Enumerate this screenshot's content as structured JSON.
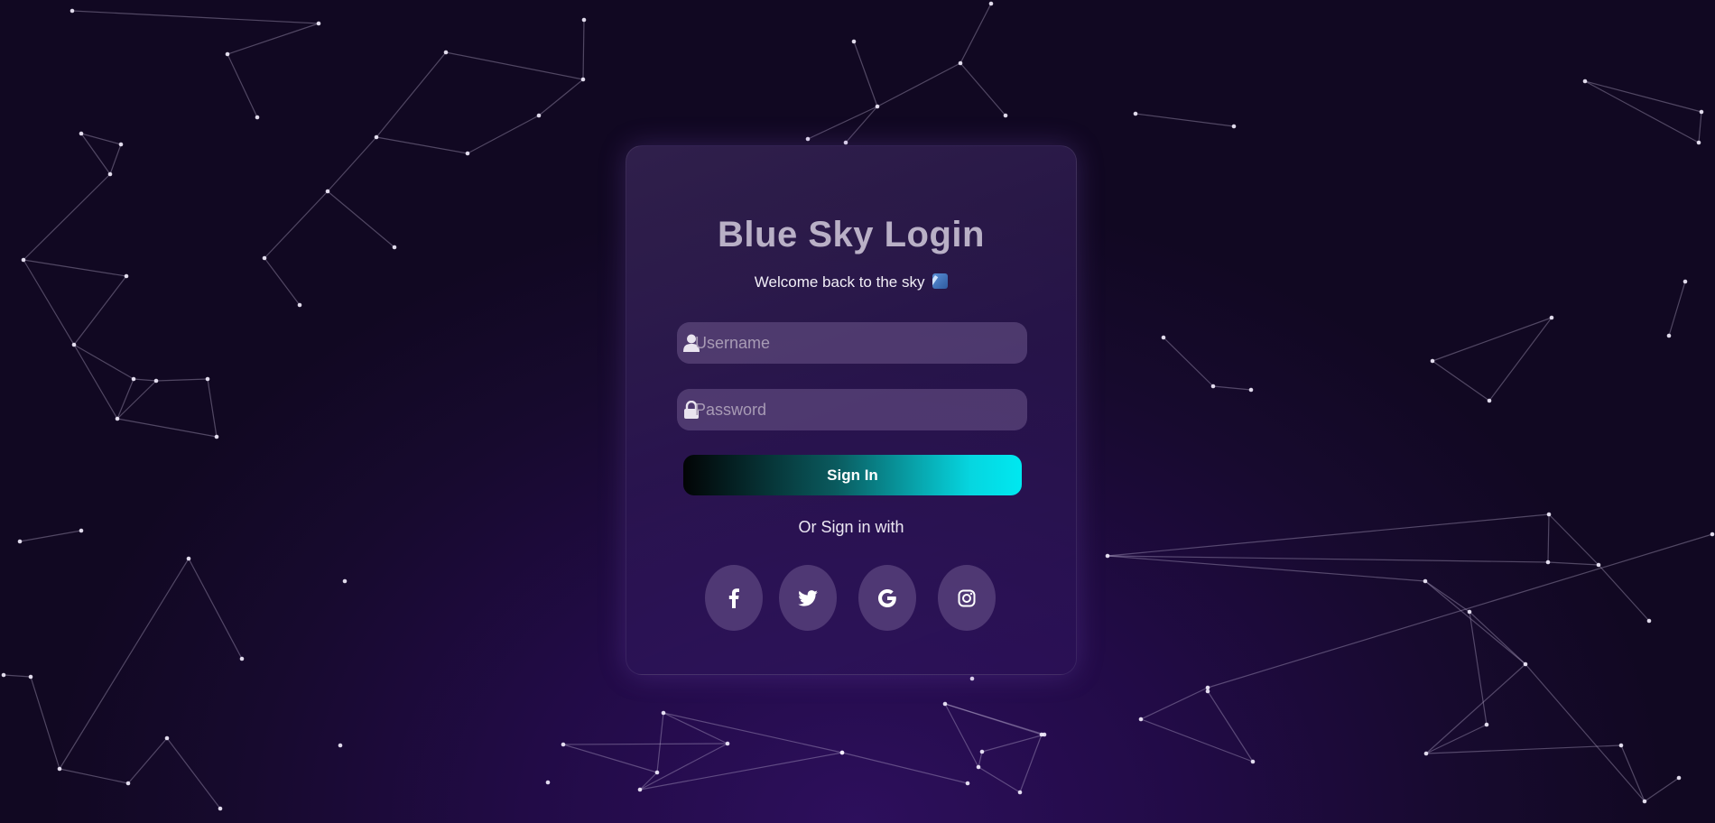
{
  "login": {
    "title": "Blue Sky Login",
    "subtitle": "Welcome back to the sky",
    "subtitle_icon": "sky-glyph-icon",
    "username_placeholder": "Username",
    "password_placeholder": "Password",
    "sign_in_label": "Sign In",
    "or_label": "Or Sign in with",
    "social": [
      {
        "name": "facebook",
        "icon": "facebook-icon"
      },
      {
        "name": "twitter",
        "icon": "twitter-icon"
      },
      {
        "name": "google",
        "icon": "google-icon"
      },
      {
        "name": "instagram",
        "icon": "instagram-icon"
      }
    ]
  },
  "colors": {
    "background": "#1c0a3a",
    "card": "#3a2466",
    "button_start": "#020405",
    "button_end": "#00e8f0",
    "title": "#b9b0c6"
  }
}
